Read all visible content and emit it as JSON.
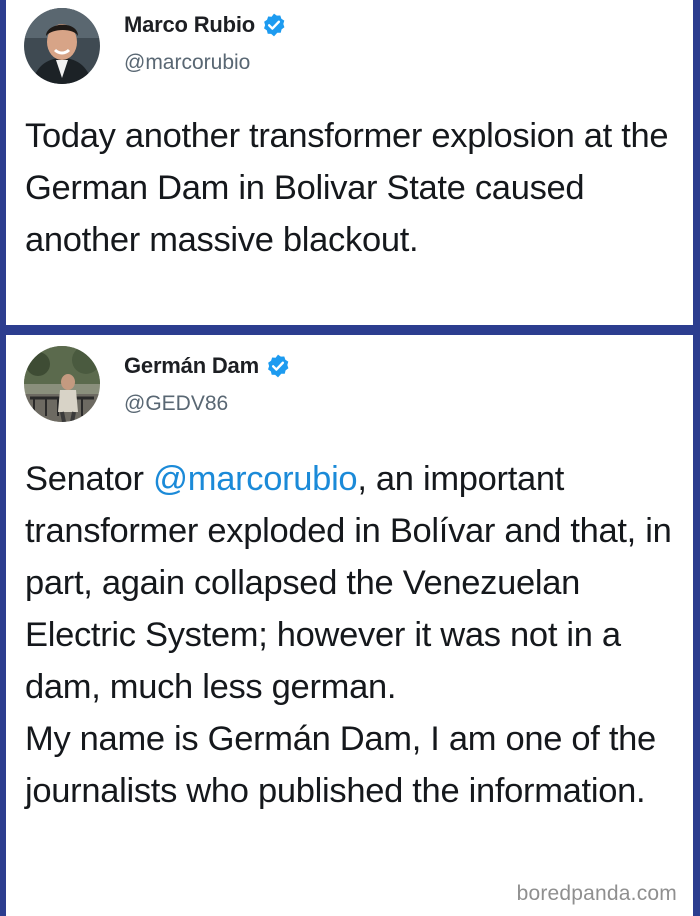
{
  "colors": {
    "frame": "#2c3d8f",
    "verified": "#1d9bf0",
    "mention": "#1b8ad8"
  },
  "tweets": [
    {
      "display_name": "Marco Rubio",
      "handle": "@marcorubio",
      "verified": true,
      "avatar_icon": "portrait-avatar",
      "text_lines": [
        "Today another transformer explosion at the German Dam in Bolivar State caused another massive blackout."
      ]
    },
    {
      "display_name": "Germán Dam",
      "handle": "@GEDV86",
      "verified": true,
      "avatar_icon": "portrait-avatar",
      "text_before_mention": "Senator ",
      "mention": "@marcorubio",
      "text_after_mention": ", an important transformer exploded in Bolívar and that, in part, again collapsed the Venezuelan Electric System; however it was not in a dam, much less german.",
      "text_second_paragraph": "My name is Germán Dam, I am one of the journalists who published the information."
    }
  ],
  "watermark": "boredpanda.com"
}
